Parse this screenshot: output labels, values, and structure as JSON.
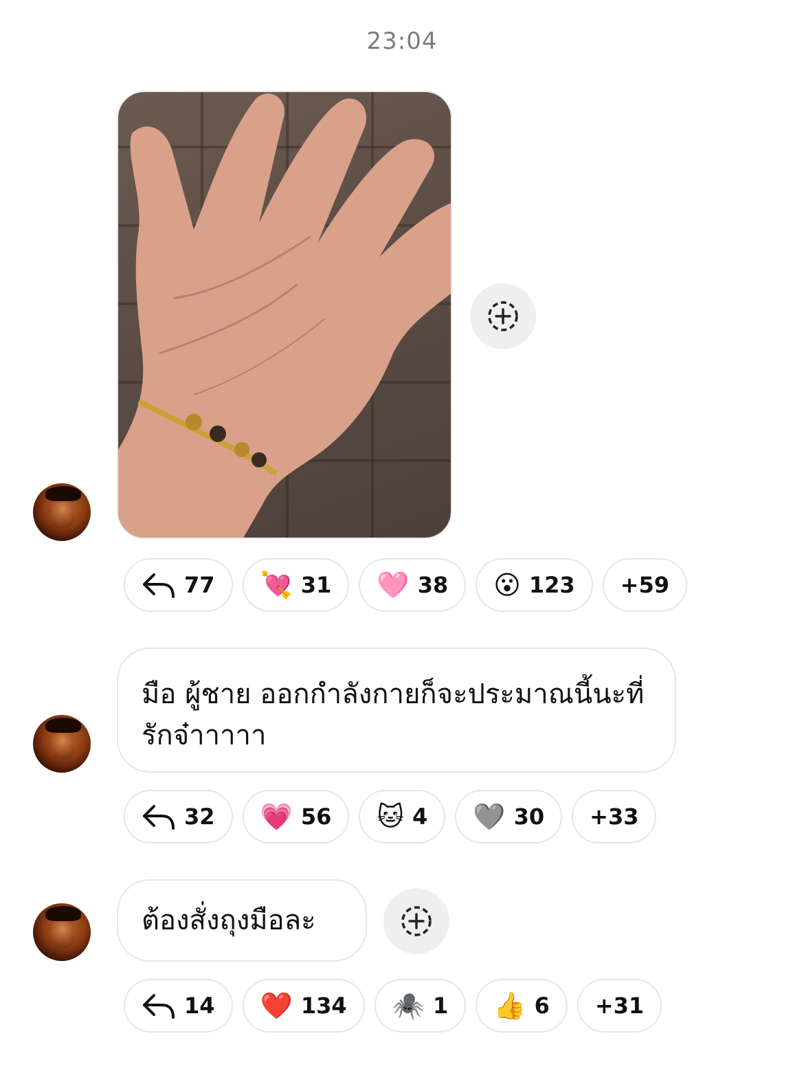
{
  "timestamp": "23:04",
  "messages": [
    {
      "type": "image",
      "reactions": [
        {
          "icon": "reply-icon",
          "count": "77"
        },
        {
          "emoji": "💘",
          "count": "31"
        },
        {
          "emoji": "🩷",
          "count": "38"
        },
        {
          "emoji": "😮",
          "count": "123"
        },
        {
          "more": "+59"
        }
      ]
    },
    {
      "type": "text",
      "text": "มือ ผู้ชาย ออกกำลังกายก็จะประมาณนี้นะที่รักจ๋าาาาา",
      "reactions": [
        {
          "icon": "reply-icon",
          "count": "32"
        },
        {
          "emoji": "💗",
          "count": "56"
        },
        {
          "emoji": "🐱",
          "count": "4"
        },
        {
          "emoji": "🩶",
          "count": "30"
        },
        {
          "more": "+33"
        }
      ]
    },
    {
      "type": "text",
      "text": "ต้องสั่งถุงมือละ",
      "reactions": [
        {
          "icon": "reply-icon",
          "count": "14"
        },
        {
          "emoji": "❤️",
          "count": "134"
        },
        {
          "emoji": "🕷️",
          "count": "1"
        },
        {
          "emoji": "👍",
          "count": "6"
        },
        {
          "more": "+31"
        }
      ]
    }
  ]
}
